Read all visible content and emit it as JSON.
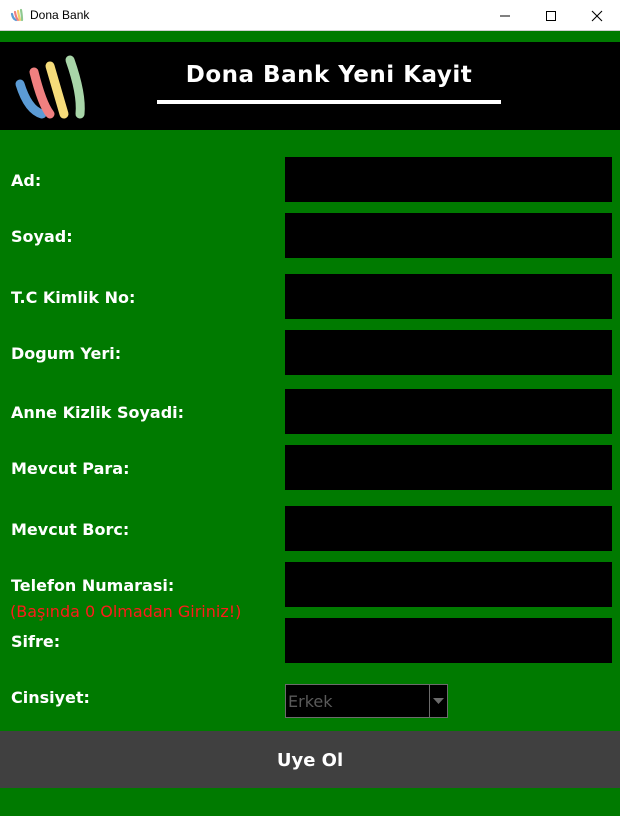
{
  "window": {
    "title": "Dona Bank",
    "icons": {
      "app": "rainbow-logo-icon",
      "minimize": "minimize-icon",
      "maximize": "maximize-icon",
      "close": "close-icon"
    }
  },
  "header": {
    "title": "Dona Bank Yeni Kayit",
    "logo": "rainbow-logo-icon",
    "colors": {
      "background": "#000000",
      "text": "#ffffff"
    }
  },
  "form": {
    "fields": {
      "ad": {
        "label": "Ad:",
        "value": ""
      },
      "soyad": {
        "label": "Soyad:",
        "value": ""
      },
      "tc": {
        "label": "T.C Kimlik No:",
        "value": ""
      },
      "dogum": {
        "label": "Dogum Yeri:",
        "value": ""
      },
      "anne": {
        "label": "Anne Kizlik Soyadi:",
        "value": ""
      },
      "para": {
        "label": "Mevcut Para:",
        "value": ""
      },
      "borc": {
        "label": "Mevcut Borc:",
        "value": ""
      },
      "telefon": {
        "label": "Telefon Numarasi:",
        "value": ""
      },
      "sifre": {
        "label": "Sifre:",
        "value": ""
      }
    },
    "telefon_note": "(Başında 0 Olmadan Giriniz!)",
    "cinsiyet": {
      "label": "Cinsiyet:",
      "selected": "Erkek"
    },
    "submit_label": "Uye Ol",
    "colors": {
      "background": "#007a00",
      "input": "#000000",
      "note": "#ff1a1a",
      "button": "#404040"
    }
  }
}
